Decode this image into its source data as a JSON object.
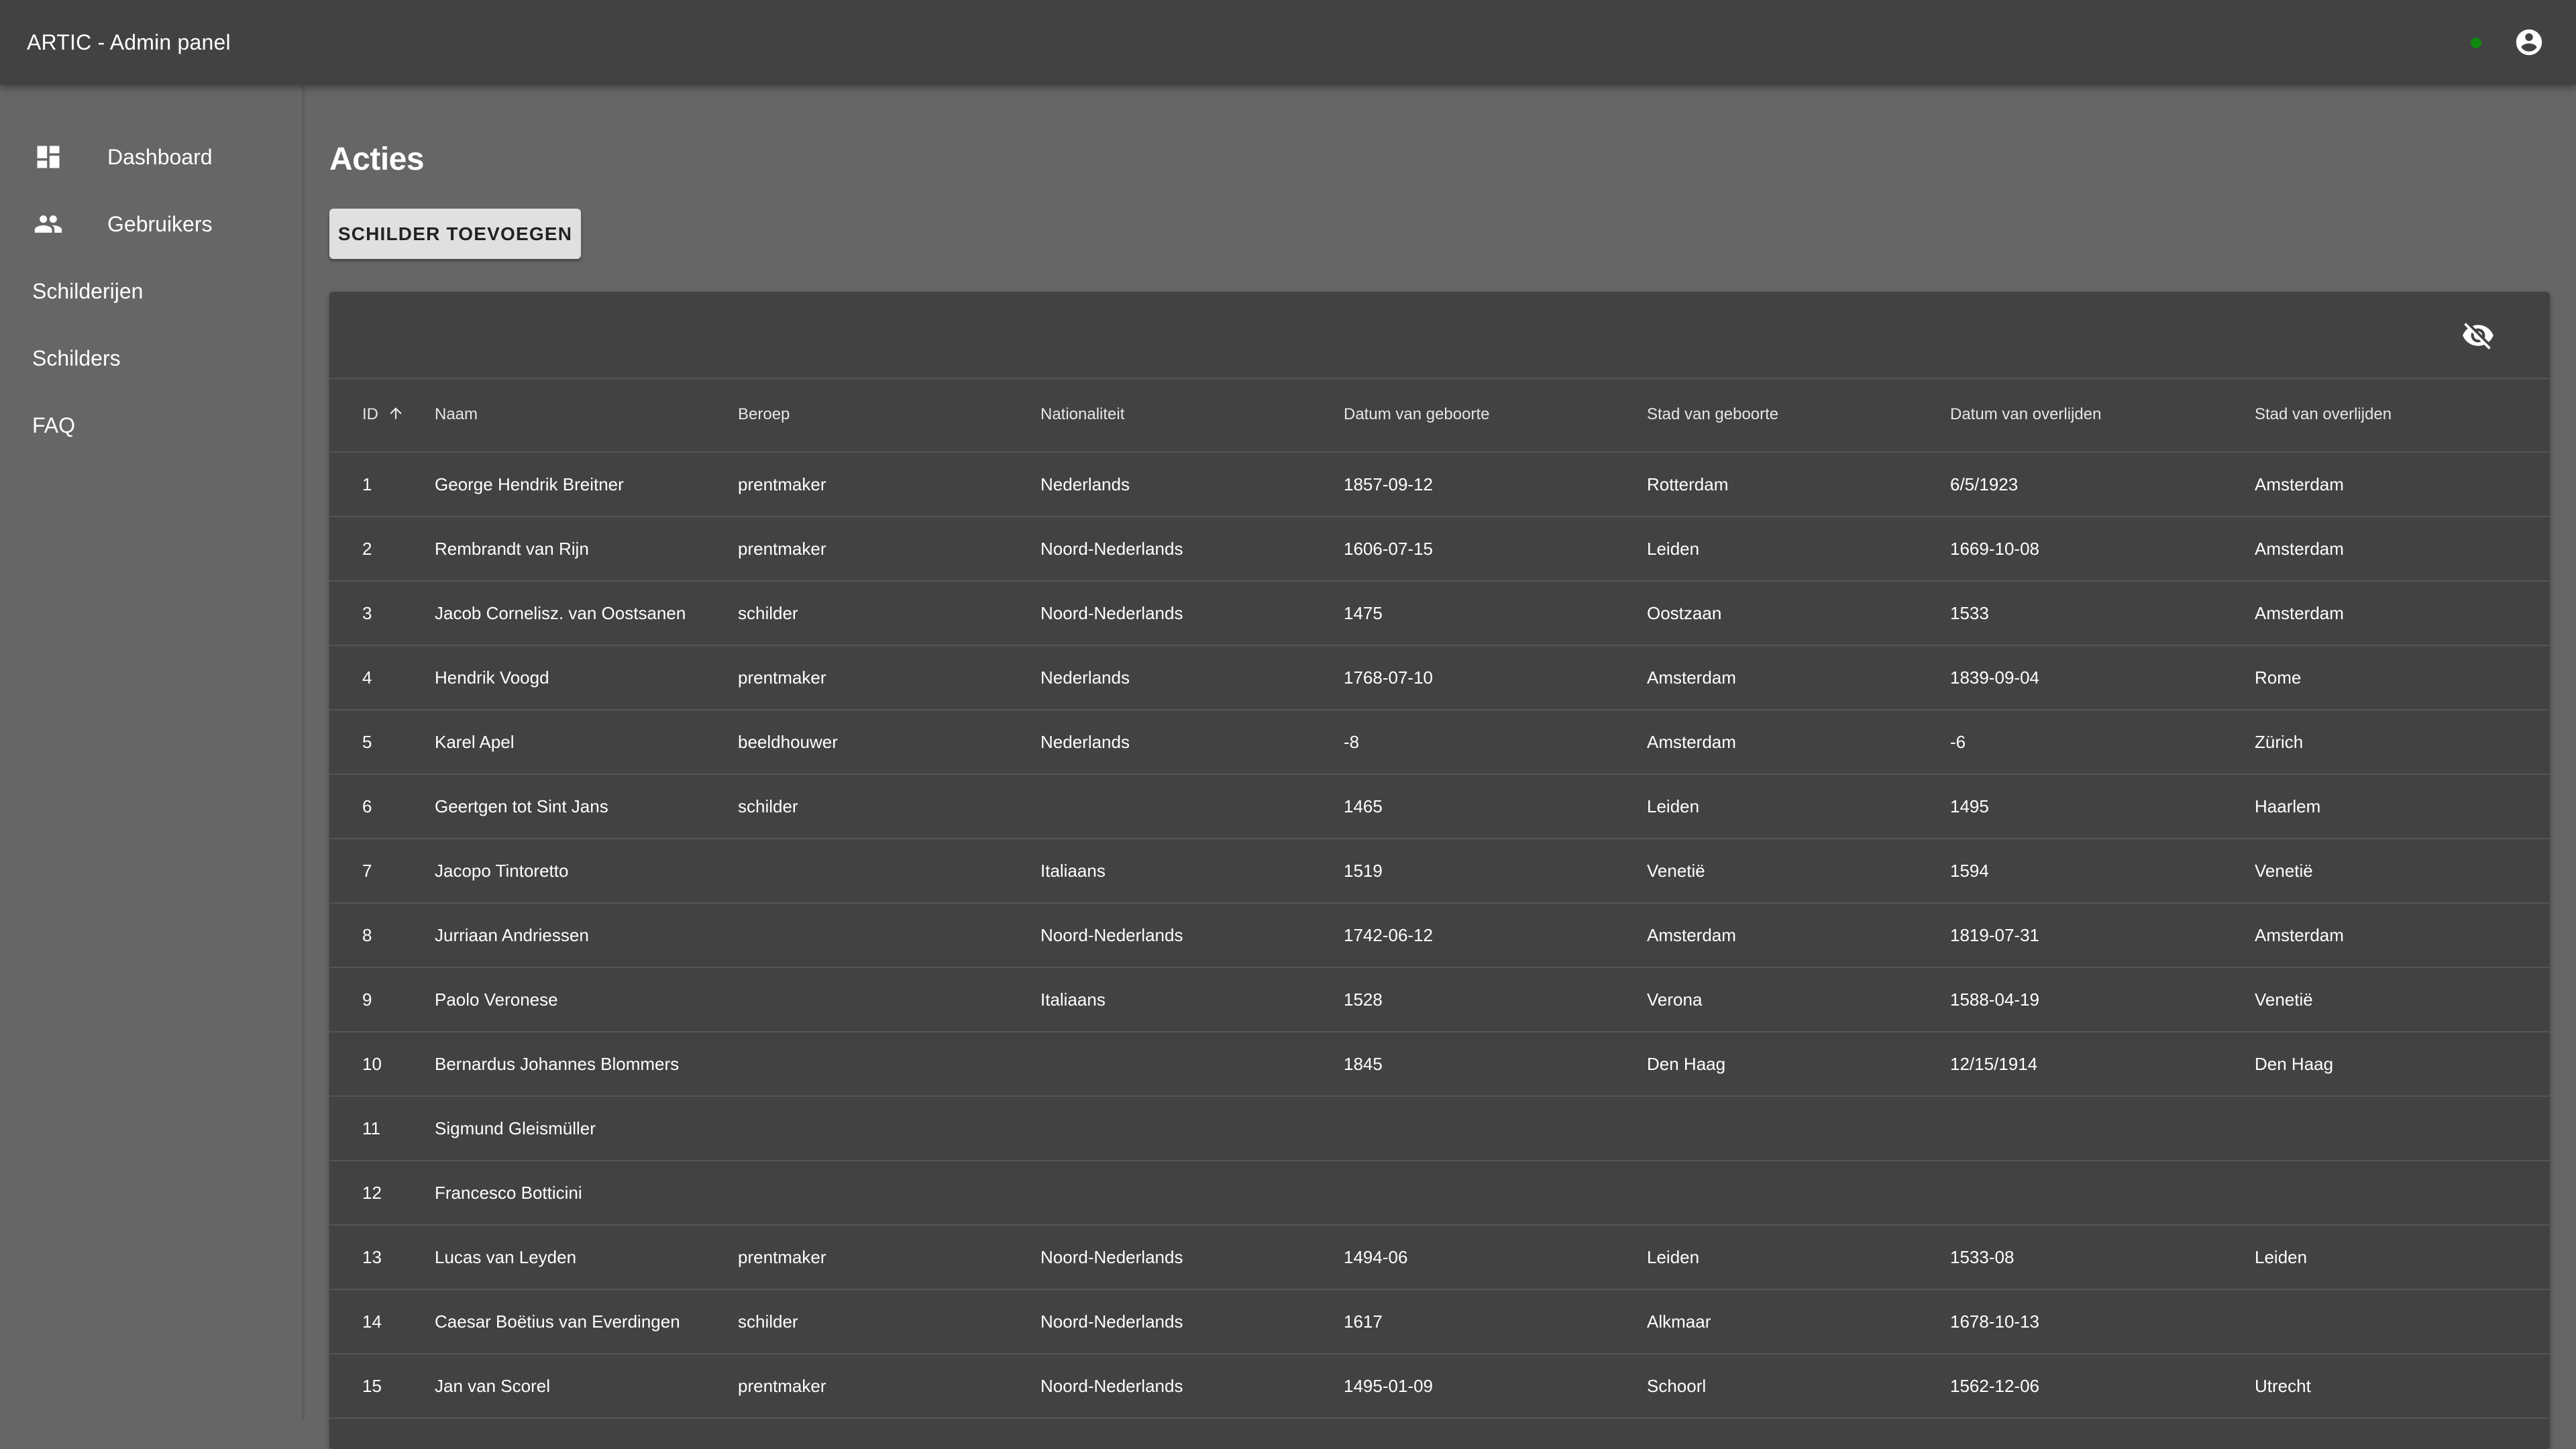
{
  "app": {
    "title": "ARTIC - Admin panel",
    "status_color": "#0f8a0f"
  },
  "sidebar": {
    "items": [
      {
        "label": "Dashboard",
        "icon": "dashboard-icon"
      },
      {
        "label": "Gebruikers",
        "icon": "people-icon"
      },
      {
        "label": "Schilderijen"
      },
      {
        "label": "Schilders"
      },
      {
        "label": "FAQ"
      }
    ]
  },
  "main": {
    "title": "Acties",
    "add_button": "Schilder toevoegen"
  },
  "table": {
    "columns": [
      "ID",
      "Naam",
      "Beroep",
      "Nationaliteit",
      "Datum van geboorte",
      "Stad van geboorte",
      "Datum van overlijden",
      "Stad van overlijden"
    ],
    "sort": {
      "column": "ID",
      "direction": "ascending"
    },
    "rows": [
      [
        "1",
        "George Hendrik Breitner",
        "prentmaker",
        "Nederlands",
        "1857-09-12",
        "Rotterdam",
        "6/5/1923",
        "Amsterdam"
      ],
      [
        "2",
        "Rembrandt van Rijn",
        "prentmaker",
        "Noord-Nederlands",
        "1606-07-15",
        "Leiden",
        "1669-10-08",
        "Amsterdam"
      ],
      [
        "3",
        "Jacob Cornelisz. van Oostsanen",
        "schilder",
        "Noord-Nederlands",
        "1475",
        "Oostzaan",
        "1533",
        "Amsterdam"
      ],
      [
        "4",
        "Hendrik Voogd",
        "prentmaker",
        "Nederlands",
        "1768-07-10",
        "Amsterdam",
        "1839-09-04",
        "Rome"
      ],
      [
        "5",
        "Karel Apel",
        "beeldhouwer",
        "Nederlands",
        "-8",
        "Amsterdam",
        "-6",
        "Zürich"
      ],
      [
        "6",
        "Geertgen tot Sint Jans",
        "schilder",
        "",
        "1465",
        "Leiden",
        "1495",
        "Haarlem"
      ],
      [
        "7",
        "Jacopo Tintoretto",
        "",
        "Italiaans",
        "1519",
        "Venetië",
        "1594",
        "Venetië"
      ],
      [
        "8",
        "Jurriaan Andriessen",
        "",
        "Noord-Nederlands",
        "1742-06-12",
        "Amsterdam",
        "1819-07-31",
        "Amsterdam"
      ],
      [
        "9",
        "Paolo Veronese",
        "",
        "Italiaans",
        "1528",
        "Verona",
        "1588-04-19",
        "Venetië"
      ],
      [
        "10",
        "Bernardus Johannes Blommers",
        "",
        "",
        "1845",
        "Den Haag",
        "12/15/1914",
        "Den Haag"
      ],
      [
        "11",
        "Sigmund Gleismüller",
        "",
        "",
        "",
        "",
        "",
        ""
      ],
      [
        "12",
        "Francesco Botticini",
        "",
        "",
        "",
        "",
        "",
        ""
      ],
      [
        "13",
        "Lucas van Leyden",
        "prentmaker",
        "Noord-Nederlands",
        "1494-06",
        "Leiden",
        "1533-08",
        "Leiden"
      ],
      [
        "14",
        "Caesar Boëtius van Everdingen",
        "schilder",
        "Noord-Nederlands",
        "1617",
        "Alkmaar",
        "1678-10-13",
        ""
      ],
      [
        "15",
        "Jan van Scorel",
        "prentmaker",
        "Noord-Nederlands",
        "1495-01-09",
        "Schoorl",
        "1562-12-06",
        "Utrecht"
      ]
    ]
  }
}
